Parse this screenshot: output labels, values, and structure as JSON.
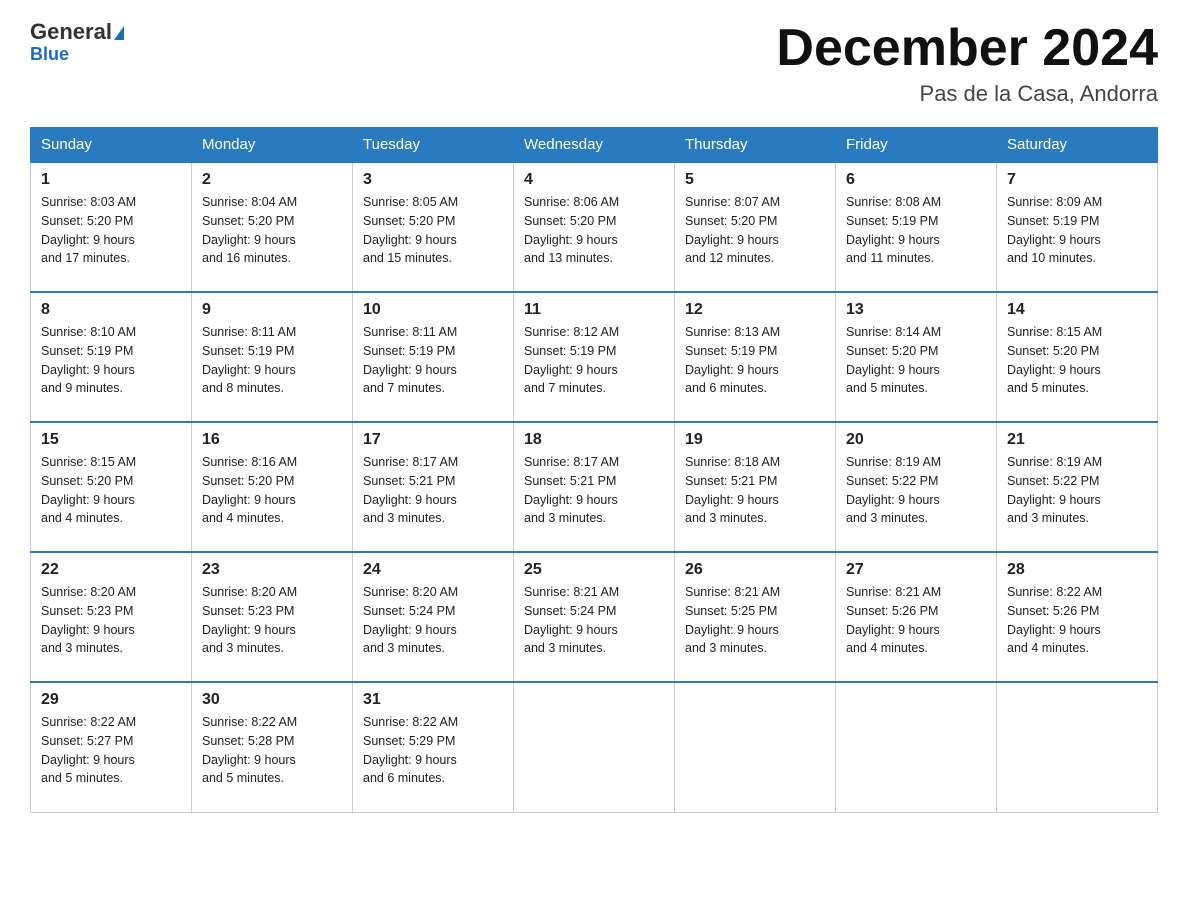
{
  "logo": {
    "text_general": "General",
    "text_blue": "Blue"
  },
  "title": "December 2024",
  "location": "Pas de la Casa, Andorra",
  "weekdays": [
    "Sunday",
    "Monday",
    "Tuesday",
    "Wednesday",
    "Thursday",
    "Friday",
    "Saturday"
  ],
  "weeks": [
    [
      {
        "day": "1",
        "sunrise": "8:03 AM",
        "sunset": "5:20 PM",
        "daylight": "9 hours and 17 minutes."
      },
      {
        "day": "2",
        "sunrise": "8:04 AM",
        "sunset": "5:20 PM",
        "daylight": "9 hours and 16 minutes."
      },
      {
        "day": "3",
        "sunrise": "8:05 AM",
        "sunset": "5:20 PM",
        "daylight": "9 hours and 15 minutes."
      },
      {
        "day": "4",
        "sunrise": "8:06 AM",
        "sunset": "5:20 PM",
        "daylight": "9 hours and 13 minutes."
      },
      {
        "day": "5",
        "sunrise": "8:07 AM",
        "sunset": "5:20 PM",
        "daylight": "9 hours and 12 minutes."
      },
      {
        "day": "6",
        "sunrise": "8:08 AM",
        "sunset": "5:19 PM",
        "daylight": "9 hours and 11 minutes."
      },
      {
        "day": "7",
        "sunrise": "8:09 AM",
        "sunset": "5:19 PM",
        "daylight": "9 hours and 10 minutes."
      }
    ],
    [
      {
        "day": "8",
        "sunrise": "8:10 AM",
        "sunset": "5:19 PM",
        "daylight": "9 hours and 9 minutes."
      },
      {
        "day": "9",
        "sunrise": "8:11 AM",
        "sunset": "5:19 PM",
        "daylight": "9 hours and 8 minutes."
      },
      {
        "day": "10",
        "sunrise": "8:11 AM",
        "sunset": "5:19 PM",
        "daylight": "9 hours and 7 minutes."
      },
      {
        "day": "11",
        "sunrise": "8:12 AM",
        "sunset": "5:19 PM",
        "daylight": "9 hours and 7 minutes."
      },
      {
        "day": "12",
        "sunrise": "8:13 AM",
        "sunset": "5:19 PM",
        "daylight": "9 hours and 6 minutes."
      },
      {
        "day": "13",
        "sunrise": "8:14 AM",
        "sunset": "5:20 PM",
        "daylight": "9 hours and 5 minutes."
      },
      {
        "day": "14",
        "sunrise": "8:15 AM",
        "sunset": "5:20 PM",
        "daylight": "9 hours and 5 minutes."
      }
    ],
    [
      {
        "day": "15",
        "sunrise": "8:15 AM",
        "sunset": "5:20 PM",
        "daylight": "9 hours and 4 minutes."
      },
      {
        "day": "16",
        "sunrise": "8:16 AM",
        "sunset": "5:20 PM",
        "daylight": "9 hours and 4 minutes."
      },
      {
        "day": "17",
        "sunrise": "8:17 AM",
        "sunset": "5:21 PM",
        "daylight": "9 hours and 3 minutes."
      },
      {
        "day": "18",
        "sunrise": "8:17 AM",
        "sunset": "5:21 PM",
        "daylight": "9 hours and 3 minutes."
      },
      {
        "day": "19",
        "sunrise": "8:18 AM",
        "sunset": "5:21 PM",
        "daylight": "9 hours and 3 minutes."
      },
      {
        "day": "20",
        "sunrise": "8:19 AM",
        "sunset": "5:22 PM",
        "daylight": "9 hours and 3 minutes."
      },
      {
        "day": "21",
        "sunrise": "8:19 AM",
        "sunset": "5:22 PM",
        "daylight": "9 hours and 3 minutes."
      }
    ],
    [
      {
        "day": "22",
        "sunrise": "8:20 AM",
        "sunset": "5:23 PM",
        "daylight": "9 hours and 3 minutes."
      },
      {
        "day": "23",
        "sunrise": "8:20 AM",
        "sunset": "5:23 PM",
        "daylight": "9 hours and 3 minutes."
      },
      {
        "day": "24",
        "sunrise": "8:20 AM",
        "sunset": "5:24 PM",
        "daylight": "9 hours and 3 minutes."
      },
      {
        "day": "25",
        "sunrise": "8:21 AM",
        "sunset": "5:24 PM",
        "daylight": "9 hours and 3 minutes."
      },
      {
        "day": "26",
        "sunrise": "8:21 AM",
        "sunset": "5:25 PM",
        "daylight": "9 hours and 3 minutes."
      },
      {
        "day": "27",
        "sunrise": "8:21 AM",
        "sunset": "5:26 PM",
        "daylight": "9 hours and 4 minutes."
      },
      {
        "day": "28",
        "sunrise": "8:22 AM",
        "sunset": "5:26 PM",
        "daylight": "9 hours and 4 minutes."
      }
    ],
    [
      {
        "day": "29",
        "sunrise": "8:22 AM",
        "sunset": "5:27 PM",
        "daylight": "9 hours and 5 minutes."
      },
      {
        "day": "30",
        "sunrise": "8:22 AM",
        "sunset": "5:28 PM",
        "daylight": "9 hours and 5 minutes."
      },
      {
        "day": "31",
        "sunrise": "8:22 AM",
        "sunset": "5:29 PM",
        "daylight": "9 hours and 6 minutes."
      },
      null,
      null,
      null,
      null
    ]
  ],
  "labels": {
    "sunrise": "Sunrise:",
    "sunset": "Sunset:",
    "daylight": "Daylight:"
  }
}
